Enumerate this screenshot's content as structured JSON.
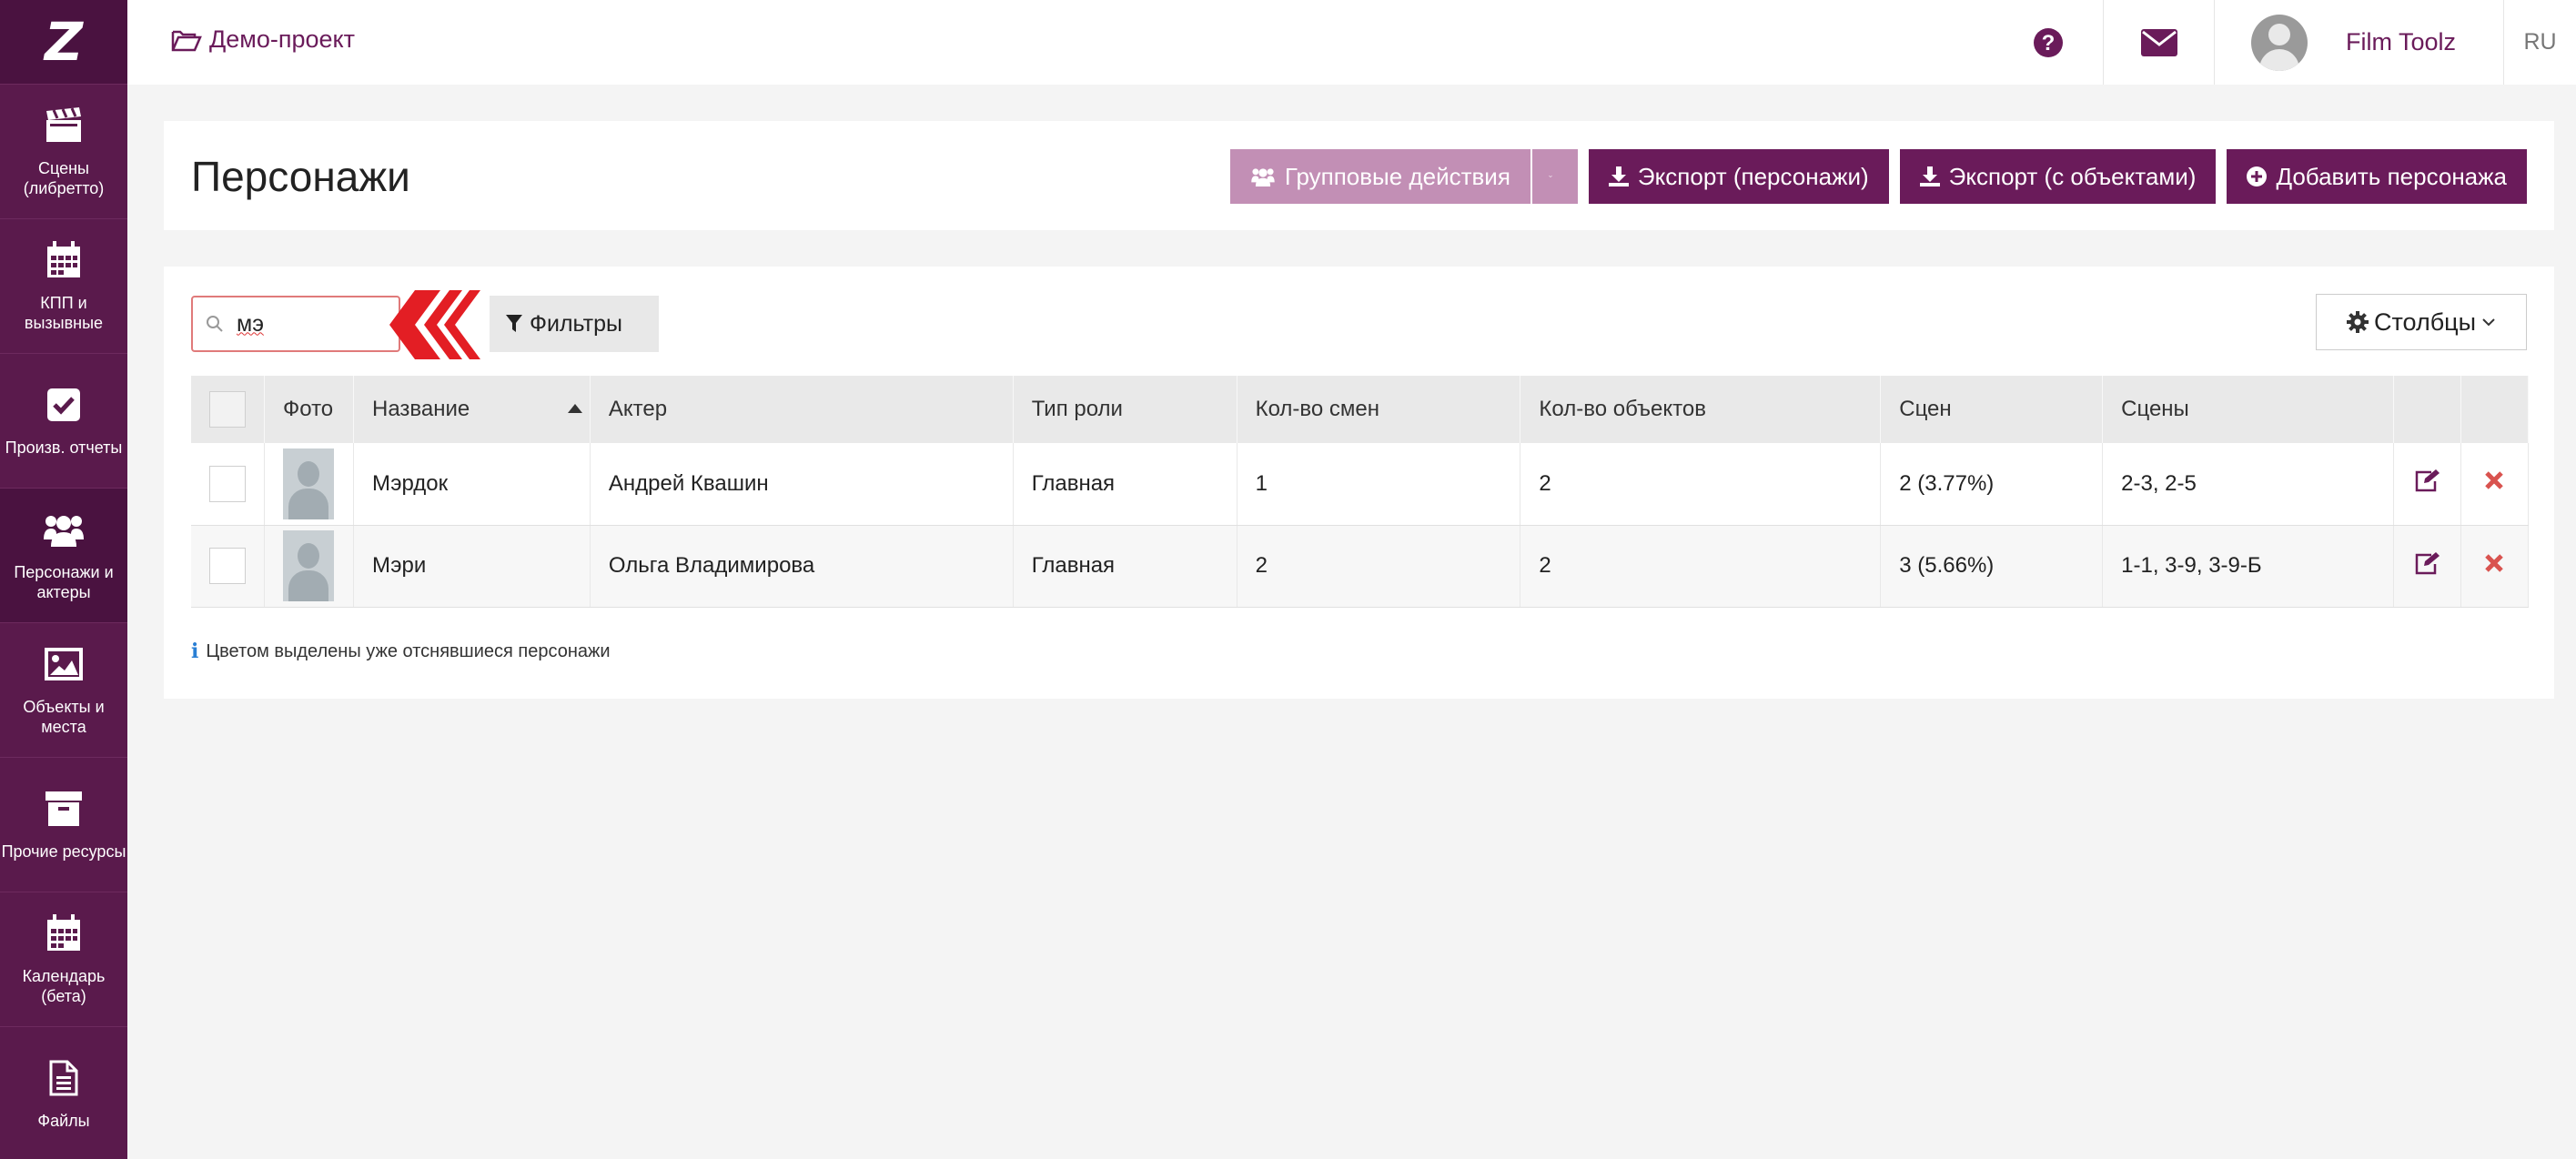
{
  "sidebar": {
    "logo": "Z",
    "items": [
      {
        "label": "Сцены (либретто)",
        "icon": "clapperboard-icon"
      },
      {
        "label": "КПП и вызывные",
        "icon": "calendar-icon"
      },
      {
        "label": "Произв. отчеты",
        "icon": "checkbox-icon"
      },
      {
        "label": "Персонажи и актеры",
        "icon": "users-icon"
      },
      {
        "label": "Объекты и места",
        "icon": "image-icon"
      },
      {
        "label": "Прочие ресурсы",
        "icon": "archive-icon"
      },
      {
        "label": "Календарь (бета)",
        "icon": "calendar-icon"
      },
      {
        "label": "Файлы",
        "icon": "file-icon"
      }
    ]
  },
  "topbar": {
    "project": "Демо-проект",
    "username": "Film Toolz",
    "lang": "RU"
  },
  "header": {
    "title": "Персонажи",
    "group_actions": "Групповые действия",
    "export_characters": "Экспорт (персонажи)",
    "export_with_objects": "Экспорт (с объектами)",
    "add_character": "Добавить персонажа"
  },
  "toolbar": {
    "search_value": "мэ",
    "filters": "Фильтры",
    "columns": "Столбцы"
  },
  "table": {
    "headers": {
      "photo": "Фото",
      "name": "Название",
      "actor": "Актер",
      "role": "Тип роли",
      "shifts": "Кол-во смен",
      "objects": "Кол-во объектов",
      "scene_count": "Сцен",
      "scenes": "Сцены"
    },
    "rows": [
      {
        "name": "Мэрдок",
        "actor": "Андрей Квашин",
        "role": "Главная",
        "shifts": "1",
        "objects": "2",
        "scene_count": "2 (3.77%)",
        "scenes": "2-3, 2-5"
      },
      {
        "name": "Мэри",
        "actor": "Ольга Владимирова",
        "role": "Главная",
        "shifts": "2",
        "objects": "2",
        "scene_count": "3 (5.66%)",
        "scenes": "1-1, 3-9, 3-9-Б"
      }
    ]
  },
  "note": "Цветом выделены уже отснявшиеся персонажи",
  "colors": {
    "brand": "#6a1b5a",
    "sidebar": "#5a1a4c",
    "delete": "#d9534f"
  }
}
